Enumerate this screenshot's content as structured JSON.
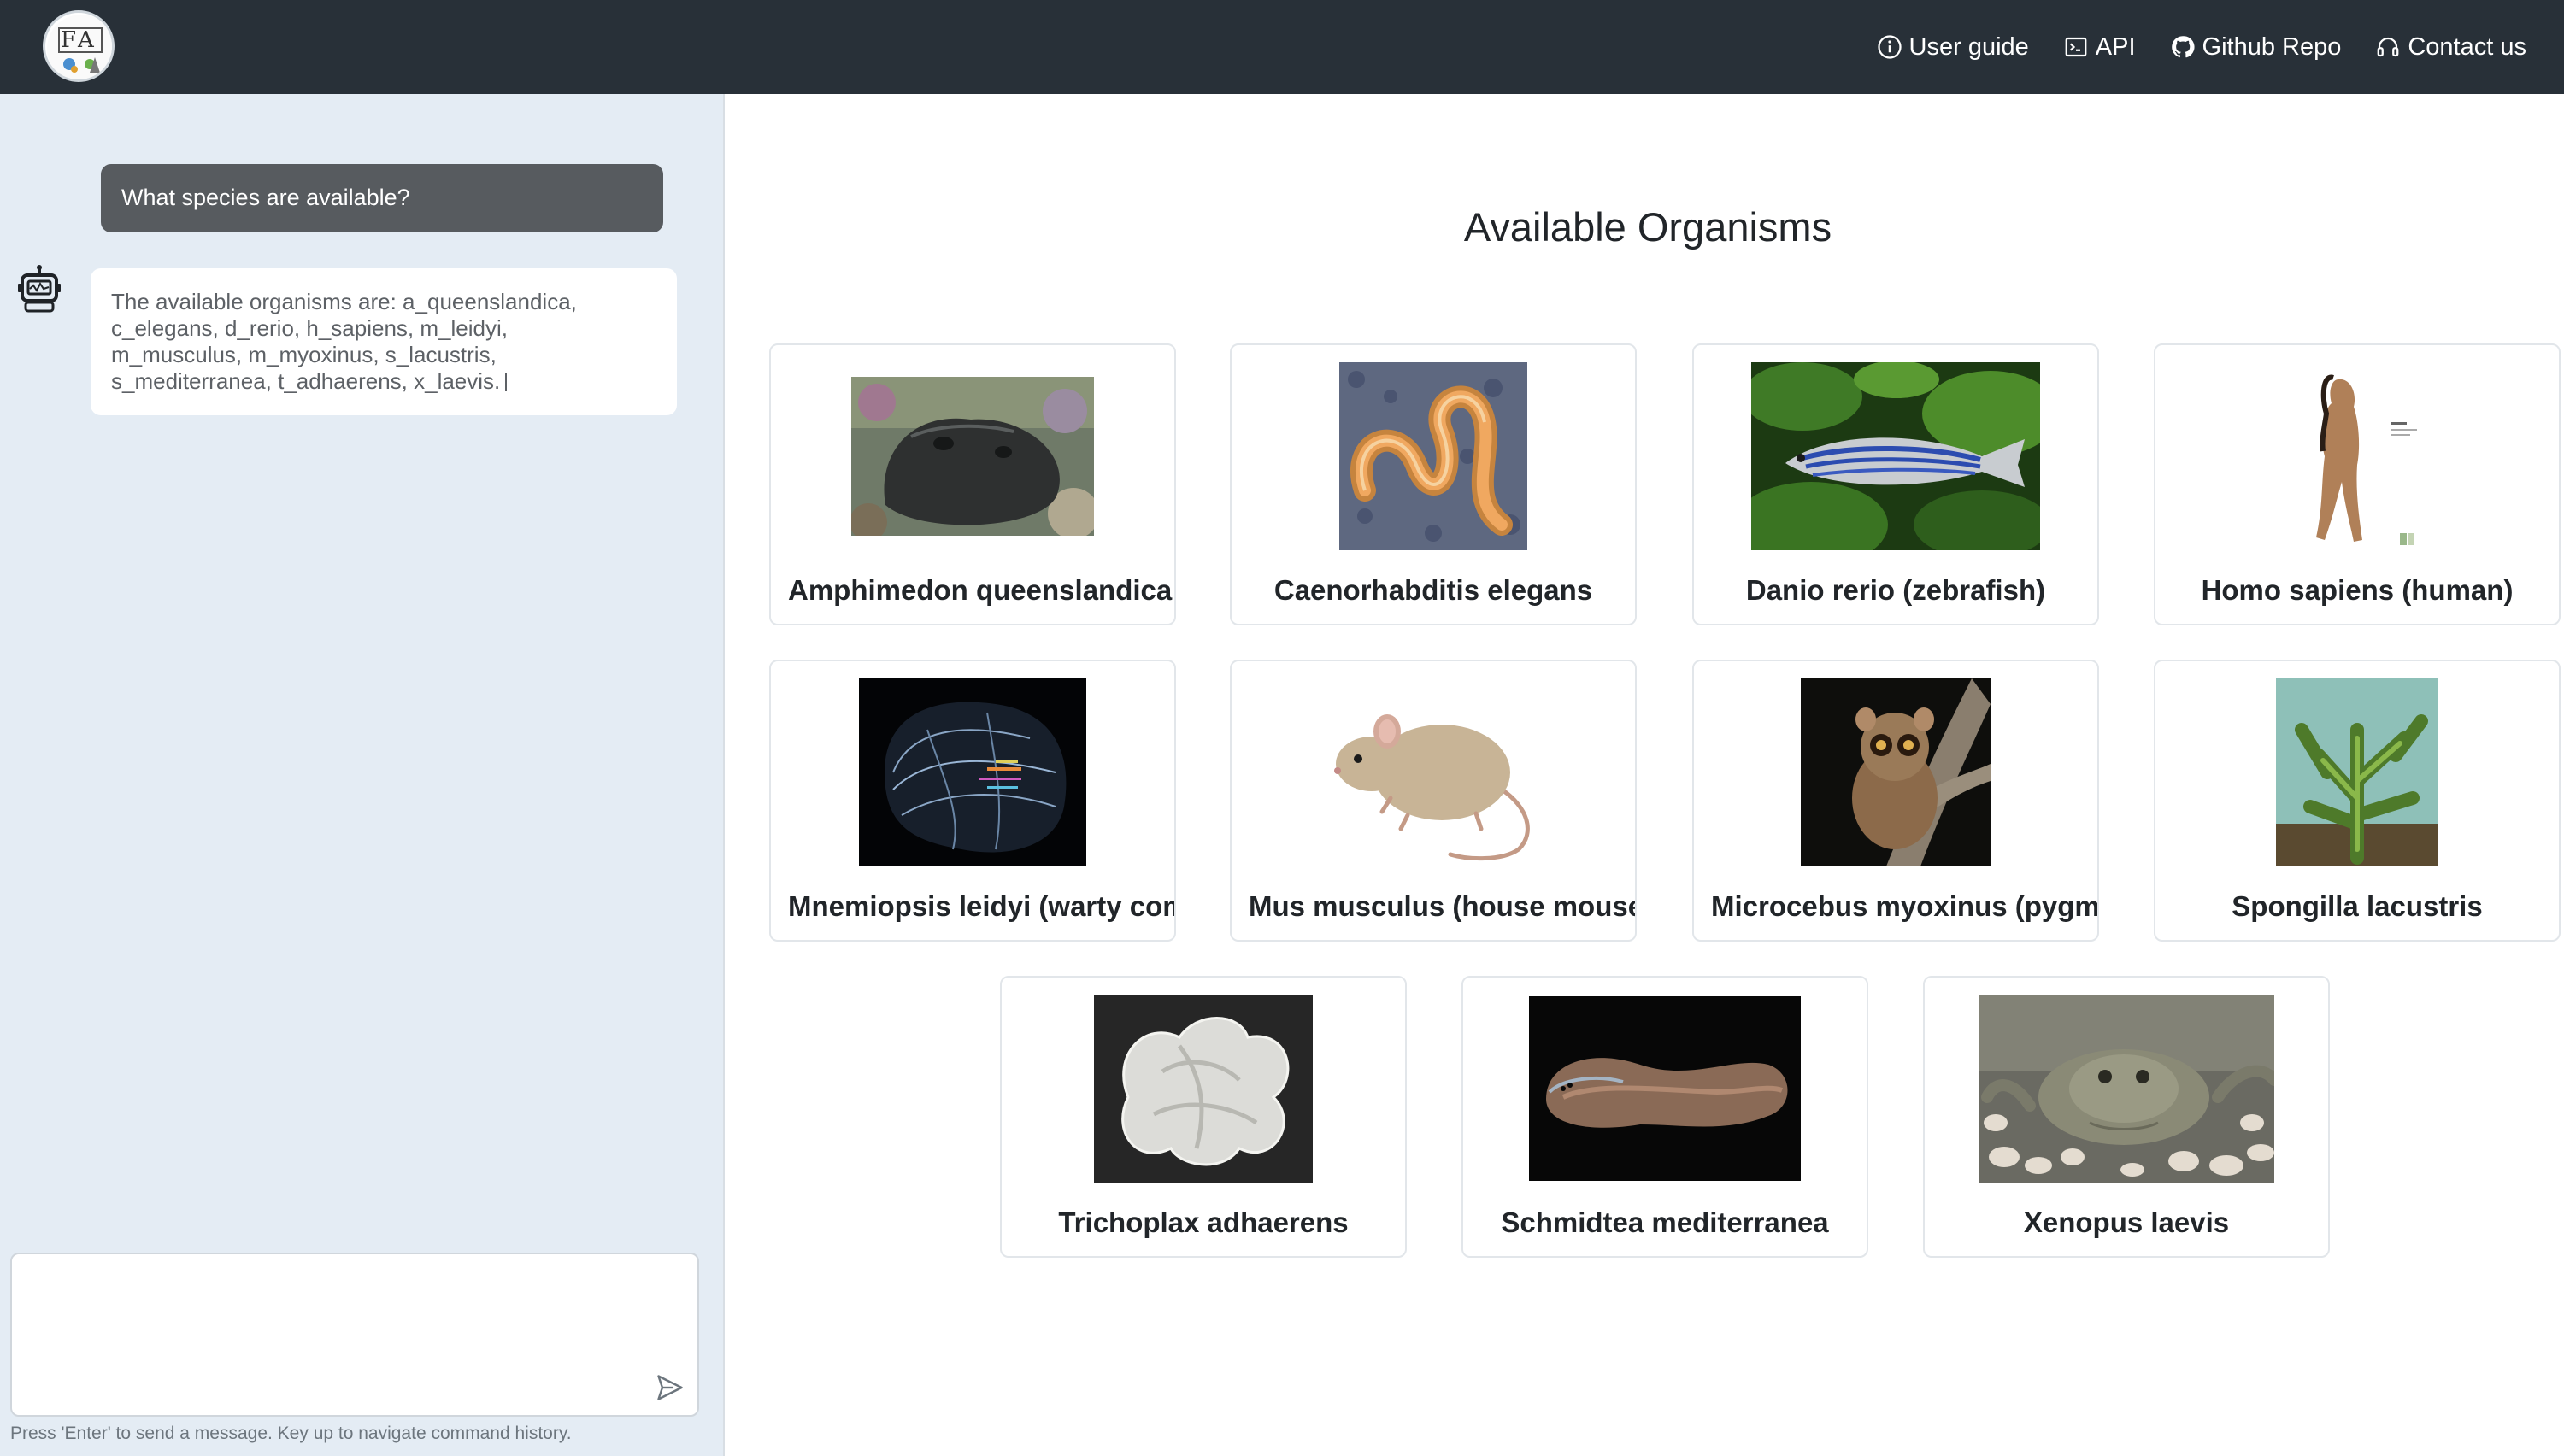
{
  "navbar": {
    "logo_icon": "fa-logo-icon",
    "links": [
      {
        "label": "User guide",
        "icon": "info-circle-icon"
      },
      {
        "label": "API",
        "icon": "terminal-icon"
      },
      {
        "label": "Github Repo",
        "icon": "github-icon"
      },
      {
        "label": "Contact us",
        "icon": "headset-icon"
      }
    ]
  },
  "chat": {
    "user_message": "What species are available?",
    "bot_lines": [
      "The available organisms are: a_queenslandica,",
      "c_elegans, d_rerio, h_sapiens, m_leidyi,",
      "m_musculus, m_myoxinus, s_lacustris,",
      "s_mediterranea, t_adhaerens, x_laevis."
    ],
    "input_value": "",
    "input_placeholder": "",
    "hint": "Press 'Enter' to send a message. Key up to navigate command history."
  },
  "main": {
    "title": "Available Organisms",
    "organisms": [
      {
        "label": "Amphimedon queenslandica",
        "image": "sponge-photo"
      },
      {
        "label": "Caenorhabditis elegans",
        "image": "nematode-photo"
      },
      {
        "label": "Danio rerio (zebrafish)",
        "image": "zebrafish-photo"
      },
      {
        "label": "Homo sapiens (human)",
        "image": "human-photo"
      },
      {
        "label": "Mnemiopsis leidyi (warty comb jelly)",
        "image": "comb-jelly-photo"
      },
      {
        "label": "Mus musculus (house mouse)",
        "image": "mouse-photo"
      },
      {
        "label": "Microcebus myoxinus (pygmy mouse lemur)",
        "image": "lemur-photo"
      },
      {
        "label": "Spongilla lacustris",
        "image": "freshwater-sponge-photo"
      },
      {
        "label": "Trichoplax adhaerens",
        "image": "trichoplax-photo"
      },
      {
        "label": "Schmidtea mediterranea",
        "image": "planarian-photo"
      },
      {
        "label": "Xenopus laevis",
        "image": "frog-photo"
      }
    ]
  }
}
